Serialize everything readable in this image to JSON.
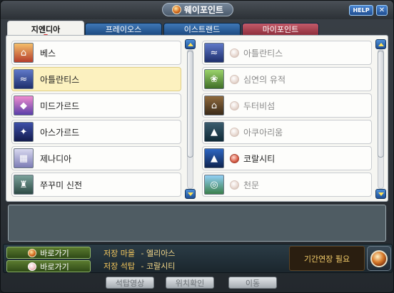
{
  "window": {
    "title": "웨이포인트",
    "help_label": "HELP",
    "close_label": "✕"
  },
  "tabs": [
    {
      "label": "지엔디아",
      "active": true
    },
    {
      "label": "프레이오스",
      "active": false
    },
    {
      "label": "이스트랜드",
      "active": false
    },
    {
      "label": "마이포인트",
      "active": false
    }
  ],
  "left_list": [
    {
      "label": "베스",
      "icon": "town-icon",
      "selected": false
    },
    {
      "label": "아틀란티스",
      "icon": "atlantis-icon",
      "selected": true
    },
    {
      "label": "미드가르드",
      "icon": "midgard-icon",
      "selected": false
    },
    {
      "label": "아스가르드",
      "icon": "asgard-icon",
      "selected": false
    },
    {
      "label": "제나디아",
      "icon": "zenadia-icon",
      "selected": false
    },
    {
      "label": "쭈꾸미 신전",
      "icon": "temple-icon",
      "selected": false
    }
  ],
  "right_list": [
    {
      "label": "아틀란티스",
      "icon": "atlantis-icon",
      "available": false
    },
    {
      "label": "심연의 유적",
      "icon": "ruins-icon",
      "available": false
    },
    {
      "label": "두터비섬",
      "icon": "island-icon",
      "available": false
    },
    {
      "label": "아쿠아리움",
      "icon": "aquarium-icon",
      "available": false
    },
    {
      "label": "코랄시티",
      "icon": "coral-city-icon",
      "available": true
    },
    {
      "label": "천문",
      "icon": "observatory-icon",
      "available": false
    }
  ],
  "bottom": {
    "shortcut_1": "바로가기",
    "shortcut_2": "바로가기",
    "save_town_label": "저장 마을",
    "save_town_value": "- 엘리아스",
    "save_stone_label": "저장 석탑",
    "save_stone_value": "- 코랄시티",
    "extend_label": "기간연장 필요"
  },
  "footer_buttons": [
    "석탑영상",
    "위치확인",
    "이동"
  ],
  "colors": {
    "tab_blue": "#1c4a80",
    "tab_red": "#8e2e3b",
    "selected_row": "#fcf1bf",
    "shortcut_green": "#5a7a2f",
    "save_text": "#f4d88a"
  }
}
